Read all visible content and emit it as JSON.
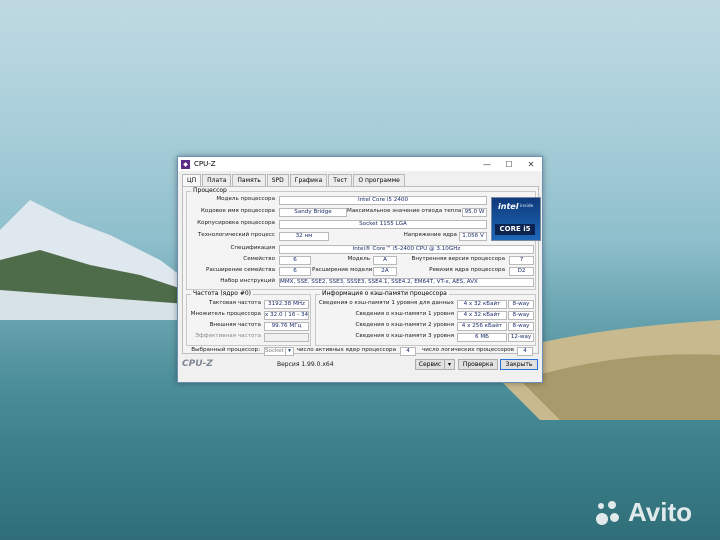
{
  "window": {
    "title": "CPU-Z",
    "icon": "cpuz-app-icon",
    "controls": {
      "minimize": "—",
      "maximize": "☐",
      "close": "✕"
    }
  },
  "tabs": [
    "ЦП",
    "Плата",
    "Память",
    "SPD",
    "Графика",
    "Тест",
    "О программе"
  ],
  "active_tab": "ЦП",
  "processor": {
    "group_label": "Процессор",
    "name_label": "Модель процессора",
    "name": "Intel Core i5 2400",
    "codename_label": "Кодовое имя процессора",
    "codename": "Sandy Bridge",
    "max_tdp_label": "Максимальное значение отвода тепла",
    "max_tdp": "95.0 W",
    "package_label": "Корпусировка процессора",
    "package": "Socket 1155 LGA",
    "technology_label": "Технологический процесс",
    "technology": "32 нм",
    "voltage_label": "Напряжение ядра",
    "voltage": "1.056 V",
    "spec_label": "Спецификация",
    "spec": "Intel® Core™ i5-2400 CPU @ 3.10GHz",
    "family_label": "Семейство",
    "family": "6",
    "model_label": "Модель",
    "model": "A",
    "stepping_label": "Внутренняя версия процессора",
    "stepping": "7",
    "ext_family_label": "Расширение семейства",
    "ext_family": "6",
    "ext_model_label": "Расширение модели",
    "ext_model": "2A",
    "revision_label": "Ревизия ядра процессора",
    "revision": "D2",
    "instructions_label": "Набор инструкций",
    "instructions": "MMX, SSE, SSE2, SSE3, SSSE3, SSE4.1, SSE4.2, EM64T, VT-x, AES, AVX",
    "logo": {
      "brand": "intel",
      "inside": "inside",
      "line": "CORE i5"
    }
  },
  "clocks": {
    "group_label": "Частота (ядро #0)",
    "core_speed_label": "Тактовая частота",
    "core_speed": "3192.38 MHz",
    "multiplier_label": "Множитель процессора",
    "multiplier": "x 32.0 ( 16 - 34 )",
    "bus_speed_label": "Внешняя частота",
    "bus_speed": "99.76 МГц",
    "rated_fsb_label": "Эффективная частота",
    "rated_fsb": ""
  },
  "cache": {
    "group_label": "Информация о кэш-памяти процессора",
    "rows": [
      {
        "label": "Сведения о кэш-памяти 1 уровня для данных",
        "size": "4 x 32 кБайт",
        "way": "8-way"
      },
      {
        "label": "Сведения о кэш-памяти 1 уровня",
        "size": "4 x 32 кБайт",
        "way": "8-way"
      },
      {
        "label": "Сведения о кэш-памяти 2 уровня",
        "size": "4 x 256 кБайт",
        "way": "8-way"
      },
      {
        "label": "Сведения о кэш-памяти 3 уровня",
        "size": "6 МБ",
        "way": "12-way"
      }
    ]
  },
  "selection": {
    "selected_label": "Выбранный процессор:",
    "selected": "Socket",
    "cores_label": "число активных ядер процессора",
    "cores": "4",
    "threads_label": "число логических процессоров",
    "threads": "4"
  },
  "footer": {
    "logo": "CPU-Z",
    "version": "Версия 1.99.0.x64",
    "service_label": "Сервис",
    "validate_label": "Проверка",
    "close_label": "Закрыть"
  },
  "watermark": "Avito"
}
